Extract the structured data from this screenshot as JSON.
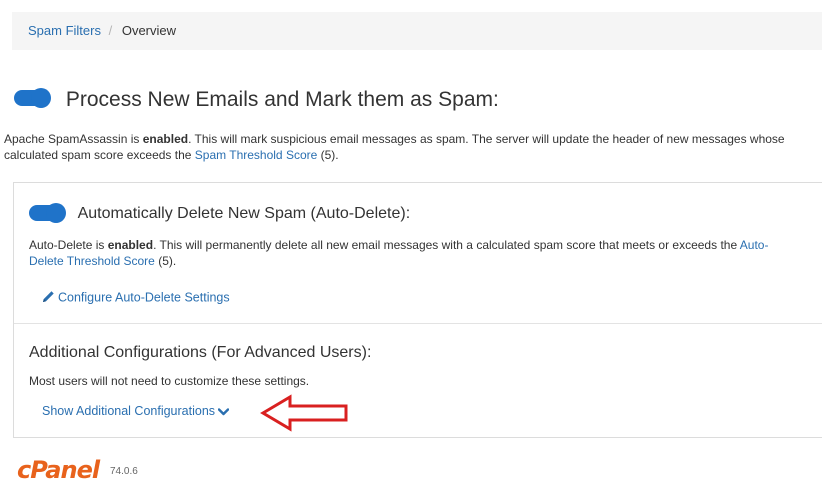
{
  "breadcrumb": {
    "parent": "Spam Filters",
    "separator": "/",
    "current": "Overview"
  },
  "main": {
    "title": "Process New Emails and Mark them as Spam:",
    "toggle_state": "on",
    "desc_1": "Apache SpamAssassin is ",
    "desc_status": "enabled",
    "desc_2": ". This will mark suspicious email messages as spam. The server will update the header of new messages whose calculated spam score exceeds the ",
    "desc_link": "Spam Threshold Score",
    "desc_3": " (5)."
  },
  "auto_delete": {
    "title": "Automatically Delete New Spam (Auto-Delete):",
    "toggle_state": "on",
    "desc_1": "Auto-Delete is ",
    "desc_status": "enabled",
    "desc_2": ". This will permanently delete all new email messages with a calculated spam score that meets or exceeds the ",
    "desc_link": "Auto-Delete Threshold Score",
    "desc_3": " (5).",
    "configure_link": "Configure Auto-Delete Settings",
    "configure_icon": "pencil-icon"
  },
  "advanced": {
    "title": "Additional Configurations (For Advanced Users):",
    "desc": "Most users will not need to customize these settings.",
    "show_link": "Show Additional Configurations",
    "show_icon": "chevron-down-icon"
  },
  "footer": {
    "logo": "cPanel",
    "version": "74.0.6"
  },
  "colors": {
    "accent": "#1f73c9",
    "link": "#2a6fb0",
    "annotation_arrow": "#d92020",
    "logo": "#e8621c"
  }
}
